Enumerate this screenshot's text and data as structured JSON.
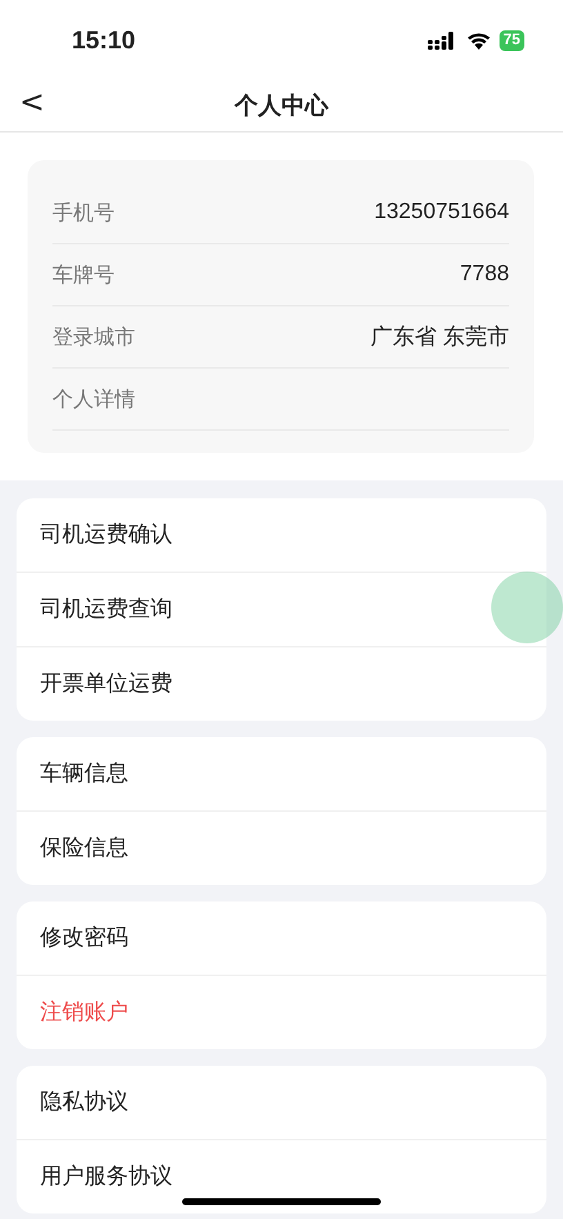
{
  "status_bar": {
    "time": "15:10",
    "battery": "75"
  },
  "header": {
    "back": "<",
    "title": "个人中心"
  },
  "profile": [
    {
      "label": "手机号",
      "value": "13250751664"
    },
    {
      "label": "车牌号",
      "value": "7788"
    },
    {
      "label": "登录城市",
      "value": "广东省 东莞市"
    },
    {
      "label": "个人详情"
    }
  ],
  "groups": [
    [
      {
        "label": "司机运费确认",
        "kind": "normal"
      },
      {
        "label": "司机运费查询",
        "kind": "normal"
      },
      {
        "label": "开票单位运费",
        "kind": "normal"
      }
    ],
    [
      {
        "label": "车辆信息",
        "kind": "normal"
      },
      {
        "label": "保险信息",
        "kind": "normal"
      }
    ],
    [
      {
        "label": "修改密码",
        "kind": "normal"
      },
      {
        "label": "注销账户",
        "kind": "danger"
      }
    ],
    [
      {
        "label": "隐私协议",
        "kind": "normal"
      },
      {
        "label": "用户服务协议",
        "kind": "normal"
      }
    ]
  ]
}
